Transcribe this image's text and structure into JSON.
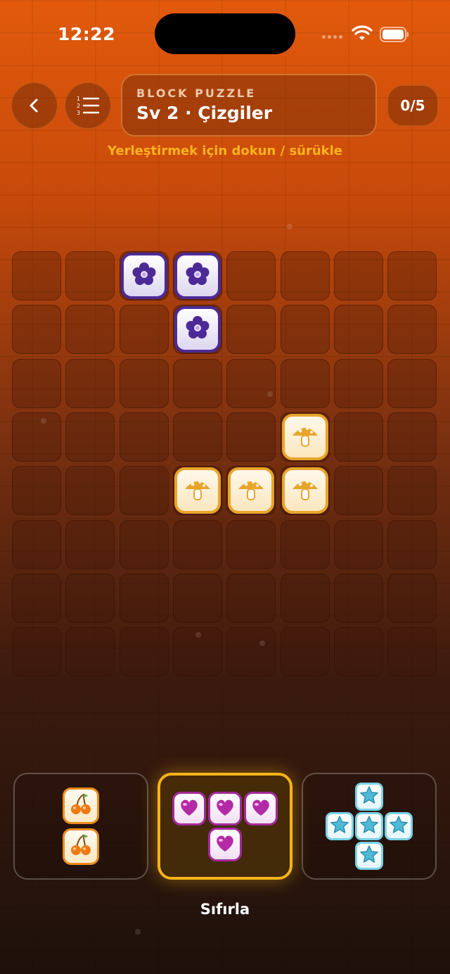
{
  "status": {
    "time": "12:22"
  },
  "header": {
    "eyebrow": "BLOCK PUZZLE",
    "title": "Sv 2 · Çizgiler",
    "score": "0/5",
    "hint": "Yerleştirmek için dokun / sürükle"
  },
  "board": {
    "rows": 8,
    "cols": 8,
    "filled": [
      {
        "row": 0,
        "col": 2,
        "kind": "violet",
        "icon": "flower-icon"
      },
      {
        "row": 0,
        "col": 3,
        "kind": "violet",
        "icon": "flower-icon"
      },
      {
        "row": 1,
        "col": 3,
        "kind": "violet",
        "icon": "flower-icon"
      },
      {
        "row": 3,
        "col": 5,
        "kind": "amber",
        "icon": "mushroom-icon"
      },
      {
        "row": 4,
        "col": 3,
        "kind": "amber",
        "icon": "mushroom-icon"
      },
      {
        "row": 4,
        "col": 4,
        "kind": "amber",
        "icon": "mushroom-icon"
      },
      {
        "row": 4,
        "col": 5,
        "kind": "amber",
        "icon": "mushroom-icon"
      }
    ]
  },
  "pieces": [
    {
      "name": "cherry",
      "icon": "cherry-icon",
      "selected": false,
      "cells": [
        [
          0,
          0
        ],
        [
          1,
          0
        ]
      ]
    },
    {
      "name": "heart",
      "icon": "heart-icon",
      "selected": true,
      "cells": [
        [
          0,
          0
        ],
        [
          0,
          1
        ],
        [
          0,
          2
        ],
        [
          1,
          1
        ]
      ]
    },
    {
      "name": "star",
      "icon": "star-icon",
      "selected": false,
      "cells": [
        [
          0,
          1
        ],
        [
          1,
          0
        ],
        [
          1,
          1
        ],
        [
          1,
          2
        ],
        [
          2,
          1
        ]
      ]
    }
  ],
  "footer": {
    "reset_label": "Sıfırla"
  },
  "colors": {
    "accent": "#f4b319",
    "violet": "#4c2a96",
    "amber": "#e8a52c",
    "heart": "#a42a9b",
    "star": "#7cd2e5"
  }
}
